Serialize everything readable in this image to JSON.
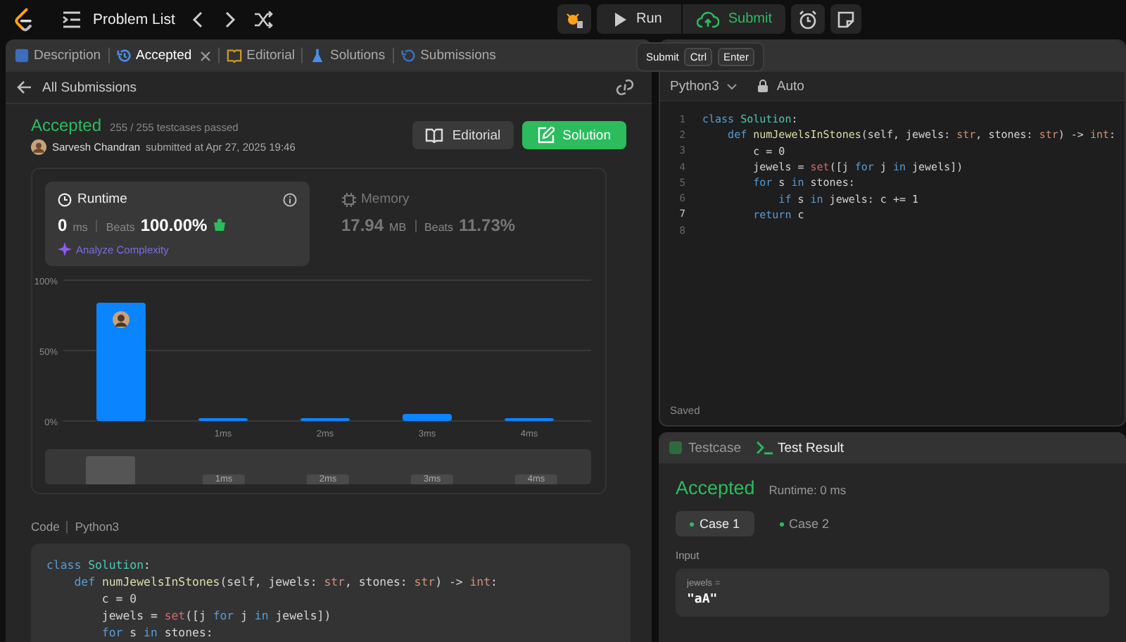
{
  "top_bar": {
    "problem_list": "Problem List",
    "run": "Run",
    "submit": "Submit"
  },
  "tabs": [
    {
      "label": "Description",
      "kind": "description",
      "selected": false,
      "closable": false
    },
    {
      "label": "Accepted",
      "kind": "status",
      "selected": true,
      "closable": true
    },
    {
      "label": "Editorial",
      "kind": "editorial",
      "selected": false,
      "closable": false
    },
    {
      "label": "Solutions",
      "kind": "solutions",
      "selected": false,
      "closable": false
    },
    {
      "label": "Submissions",
      "kind": "submissions",
      "selected": false,
      "closable": false
    }
  ],
  "tooltip": {
    "label": "Submit",
    "keys": [
      "Ctrl",
      "Enter"
    ]
  },
  "submission": {
    "back_label": "All Submissions",
    "status": "Accepted",
    "testcases": "255 / 255 testcases passed",
    "author": "Sarvesh Chandran",
    "submitted": "submitted at Apr 27, 2025 19:46",
    "buttons": [
      {
        "label": "Editorial",
        "kind": "secondary"
      },
      {
        "label": "Solution",
        "kind": "primary"
      }
    ]
  },
  "stats": [
    {
      "title": "Runtime",
      "kind": "runtime",
      "selected": true,
      "value": "0",
      "unit": "ms",
      "beats_label": "Beats",
      "beats": "100.00%",
      "link": "Analyze Complexity"
    },
    {
      "title": "Memory",
      "kind": "memory",
      "selected": false,
      "value": "17.94",
      "unit": "MB",
      "beats_label": "Beats",
      "beats": "11.73%"
    }
  ],
  "chart_data": {
    "type": "bar",
    "categories": [
      null,
      "1ms",
      "2ms",
      "3ms",
      "4ms"
    ],
    "series": [
      {
        "color": "#0a84ff",
        "values": [
          84,
          2,
          2,
          5,
          2
        ]
      }
    ],
    "ylim": [
      0,
      100
    ],
    "yticks": [
      {
        "value": 0,
        "label": "0%"
      },
      {
        "value": 50,
        "label": "50%"
      },
      {
        "value": 100,
        "label": "100%"
      }
    ]
  },
  "navigator": {
    "labels": [
      "1ms",
      "2ms",
      "3ms",
      "4ms"
    ]
  },
  "code_section": {
    "label": "Code",
    "language": "Python3",
    "lines": [
      [
        {
          "text": "class ",
          "kind": "kw"
        },
        {
          "text": "Solution",
          "kind": "cls"
        },
        {
          "text": ":",
          "kind": "plain"
        }
      ],
      [
        {
          "text": "    def ",
          "kind": "kw"
        },
        {
          "text": "numJewelsInStones",
          "kind": "fn"
        },
        {
          "text": "(self, jewels: ",
          "kind": "plain"
        },
        {
          "text": "str",
          "kind": "type"
        },
        {
          "text": ", stones: ",
          "kind": "plain"
        },
        {
          "text": "str",
          "kind": "type"
        },
        {
          "text": ") -> ",
          "kind": "plain"
        },
        {
          "text": "int",
          "kind": "type"
        },
        {
          "text": ":",
          "kind": "plain"
        }
      ],
      [
        {
          "text": "        c = 0",
          "kind": "plain"
        }
      ],
      [
        {
          "text": "        jewels = ",
          "kind": "plain"
        },
        {
          "text": "set",
          "kind": "builtin"
        },
        {
          "text": "([j ",
          "kind": "plain"
        },
        {
          "text": "for",
          "kind": "kw"
        },
        {
          "text": " j ",
          "kind": "plain"
        },
        {
          "text": "in",
          "kind": "kw"
        },
        {
          "text": " jewels])",
          "kind": "plain"
        }
      ],
      [
        {
          "text": "        for",
          "kind": "kw"
        },
        {
          "text": " s ",
          "kind": "plain"
        },
        {
          "text": "in",
          "kind": "kw"
        },
        {
          "text": " stones:",
          "kind": "plain"
        }
      ]
    ]
  },
  "editor": {
    "language": "Python3",
    "mode": "Auto",
    "status": "Saved",
    "lines": [
      {
        "n": "1",
        "current": false,
        "tokens": [
          {
            "text": "class ",
            "kind": "kw"
          },
          {
            "text": "Solution",
            "kind": "cls"
          },
          {
            "text": ":",
            "kind": "plain"
          }
        ]
      },
      {
        "n": "2",
        "current": false,
        "tokens": [
          {
            "text": "    def ",
            "kind": "kw"
          },
          {
            "text": "numJewelsInStones",
            "kind": "fn"
          },
          {
            "text": "(self, jewels: ",
            "kind": "plain"
          },
          {
            "text": "str",
            "kind": "type"
          },
          {
            "text": ", stones: ",
            "kind": "plain"
          },
          {
            "text": "str",
            "kind": "type"
          },
          {
            "text": ") -> ",
            "kind": "plain"
          },
          {
            "text": "int",
            "kind": "type"
          },
          {
            "text": ":",
            "kind": "plain"
          }
        ]
      },
      {
        "n": "3",
        "current": false,
        "tokens": [
          {
            "text": "        c = 0",
            "kind": "plain"
          }
        ]
      },
      {
        "n": "4",
        "current": false,
        "tokens": [
          {
            "text": "        jewels = ",
            "kind": "plain"
          },
          {
            "text": "set",
            "kind": "builtin"
          },
          {
            "text": "([j ",
            "kind": "plain"
          },
          {
            "text": "for",
            "kind": "kw"
          },
          {
            "text": " j ",
            "kind": "plain"
          },
          {
            "text": "in",
            "kind": "kw"
          },
          {
            "text": " jewels])",
            "kind": "plain"
          }
        ]
      },
      {
        "n": "5",
        "current": false,
        "tokens": [
          {
            "text": "        for",
            "kind": "kw"
          },
          {
            "text": " s ",
            "kind": "plain"
          },
          {
            "text": "in",
            "kind": "kw"
          },
          {
            "text": " stones:",
            "kind": "plain"
          }
        ]
      },
      {
        "n": "6",
        "current": false,
        "tokens": [
          {
            "text": "            if",
            "kind": "kw"
          },
          {
            "text": " s ",
            "kind": "plain"
          },
          {
            "text": "in",
            "kind": "kw"
          },
          {
            "text": " jewels: c += 1",
            "kind": "plain"
          }
        ]
      },
      {
        "n": "7",
        "current": true,
        "tokens": [
          {
            "text": "        return",
            "kind": "kw"
          },
          {
            "text": " c",
            "kind": "plain"
          }
        ]
      },
      {
        "n": "8",
        "current": false
      }
    ]
  },
  "console": {
    "tabs": [
      {
        "label": "Testcase",
        "kind": "testcase",
        "selected": false
      },
      {
        "label": "Test Result",
        "kind": "result",
        "selected": true
      }
    ],
    "status": "Accepted",
    "runtime": "Runtime: 0 ms",
    "cases": [
      {
        "label": "Case 1",
        "selected": true
      },
      {
        "label": "Case 2",
        "selected": false
      }
    ],
    "input_label": "Input",
    "inputs": [
      {
        "name": "jewels =",
        "value": "\"aA\""
      }
    ]
  }
}
